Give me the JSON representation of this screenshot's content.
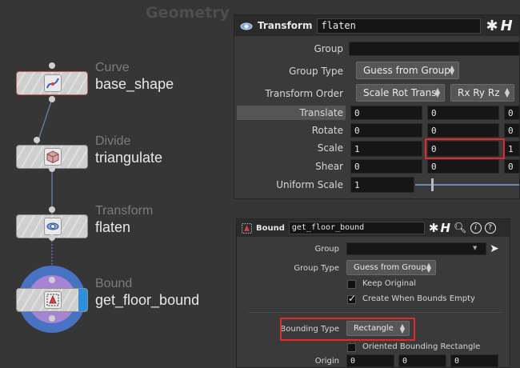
{
  "network": {
    "title": "Geometry",
    "nodes": [
      {
        "type": "Curve",
        "name": "base_shape",
        "icon": "curve-icon"
      },
      {
        "type": "Divide",
        "name": "triangulate",
        "icon": "cube-icon"
      },
      {
        "type": "Transform",
        "name": "flaten",
        "icon": "transform-icon"
      },
      {
        "type": "Bound",
        "name": "get_floor_bound",
        "icon": "bound-icon"
      }
    ]
  },
  "transform_panel": {
    "op_type": "Transform",
    "node_name": "flaten",
    "group_label": "Group",
    "group_value": "",
    "group_type_label": "Group Type",
    "group_type_value": "Guess from Group",
    "transform_order_label": "Transform Order",
    "transform_order_value": "Scale Rot Trans",
    "rotate_order_value": "Rx Ry Rz",
    "translate_label": "Translate",
    "translate": [
      "0",
      "0",
      "0"
    ],
    "rotate_label": "Rotate",
    "rotate": [
      "0",
      "0",
      "0"
    ],
    "scale_label": "Scale",
    "scale": [
      "1",
      "0",
      "1"
    ],
    "shear_label": "Shear",
    "shear": [
      "0",
      "0",
      "0"
    ],
    "uniform_scale_label": "Uniform Scale",
    "uniform_scale_value": "1"
  },
  "bound_panel": {
    "op_type": "Bound",
    "node_name": "get_floor_bound",
    "group_label": "Group",
    "group_value": "",
    "group_type_label": "Group Type",
    "group_type_value": "Guess from Group",
    "keep_original_label": "Keep Original",
    "keep_original_checked": false,
    "create_empty_label": "Create When Bounds Empty",
    "create_empty_checked": true,
    "bounding_type_label": "Bounding Type",
    "bounding_type_value": "Rectangle",
    "oriented_label": "Oriented Bounding Rectangle",
    "oriented_checked": false,
    "origin_label": "Origin",
    "origin": [
      "0",
      "0",
      "0"
    ]
  },
  "colors": {
    "highlight": "#e12a2a",
    "display_flag": "#2e8fdc",
    "bound_ring_outer": "#4872c2",
    "bound_ring_inner": "#a683d3"
  }
}
